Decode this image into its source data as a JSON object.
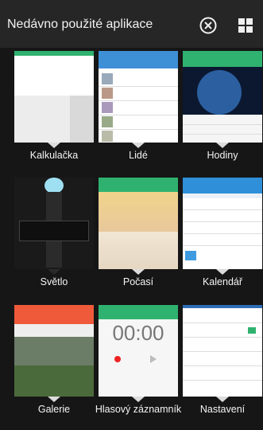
{
  "header": {
    "title": "Nedávno použité aplikace",
    "close_icon": "close-circle-icon",
    "grid_icon": "grid-view-icon"
  },
  "apps": [
    {
      "label": "Kalkulačka",
      "color": "#2fb26f"
    },
    {
      "label": "Lidé",
      "color": "#3d8fd6"
    },
    {
      "label": "Hodiny",
      "color": "#2fb26f"
    },
    {
      "label": "Světlo",
      "color": "#1a1a1a"
    },
    {
      "label": "Počasí",
      "color": "#2fb26f"
    },
    {
      "label": "Kalendář",
      "color": "#2f8fd8"
    },
    {
      "label": "Galerie",
      "color": "#ef5a3a"
    },
    {
      "label": "Hlasový záznamník",
      "color": "#2fb26f"
    },
    {
      "label": "Nastavení",
      "color": "#2e6db5"
    }
  ],
  "voice_recorder": {
    "time": "00:00"
  }
}
